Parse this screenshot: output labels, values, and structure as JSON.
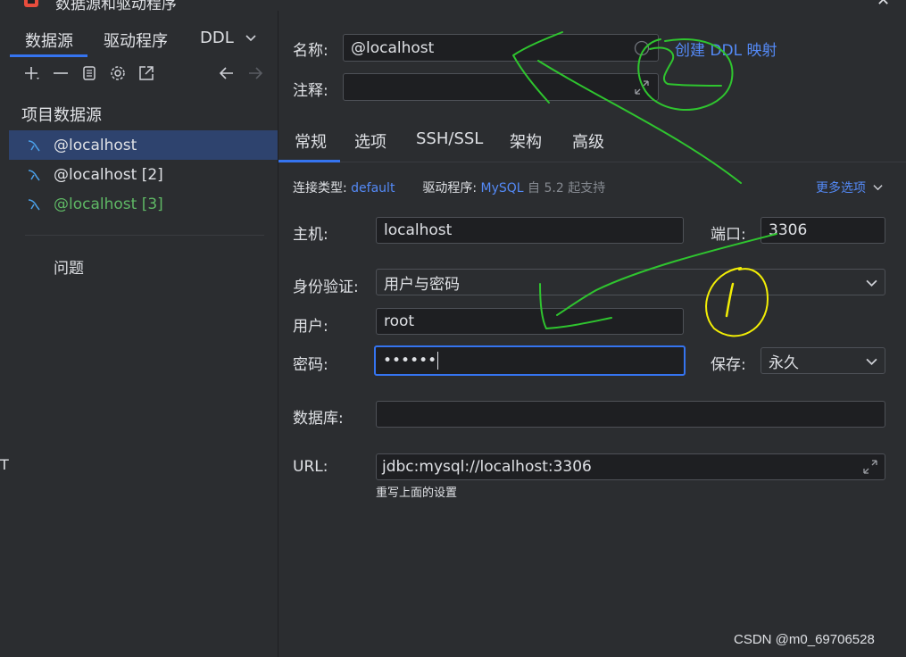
{
  "window": {
    "title": "数据源和驱动程序",
    "close_glyph": "✕"
  },
  "left": {
    "tabs": [
      "数据源",
      "驱动程序",
      "DDL"
    ],
    "project_title": "项目数据源",
    "datasources": [
      {
        "label": "@localhost",
        "color": "#dfe1e5",
        "selected": true
      },
      {
        "label": "@localhost [2]",
        "color": "#dfe1e5",
        "selected": false
      },
      {
        "label": "@localhost [3]",
        "color": "#5fb865",
        "selected": false
      }
    ],
    "problems": "问题",
    "edge_mark": "T",
    "toolbar_icons": [
      "add-icon",
      "remove-icon",
      "copy-icon",
      "settings-icon",
      "goto-icon",
      "back-arrow-icon",
      "forward-arrow-icon"
    ]
  },
  "right": {
    "name_label": "名称:",
    "name_value": "@localhost",
    "create_ddl_link": "创建 DDL 映射",
    "comment_label": "注释:",
    "comment_value": "",
    "tabs": [
      "常规",
      "选项",
      "SSH/SSL",
      "架构",
      "高级"
    ],
    "conn_type_label": "连接类型:",
    "conn_type_value": "default",
    "driver_label": "驱动程序:",
    "driver_value": "MySQL",
    "driver_support": "自 5.2 起支持",
    "more_options": "更多选项",
    "host_label": "主机:",
    "host_value": "localhost",
    "port_label": "端口:",
    "port_value": "3306",
    "auth_label": "身份验证:",
    "auth_value": "用户与密码",
    "user_label": "用户:",
    "user_value": "root",
    "password_label": "密码:",
    "password_value": "••••••",
    "save_label": "保存:",
    "save_value": "永久",
    "database_label": "数据库:",
    "database_value": "",
    "url_label": "URL:",
    "url_value": "jdbc:mysql://localhost:3306",
    "url_hint": "重写上面的设置"
  },
  "annotation_text": {
    "circle_one": "1",
    "circle_two": "2"
  },
  "watermark": "CSDN @m0_69706528",
  "colors": {
    "accent": "#3574f0",
    "link": "#548af7",
    "green_ds": "#5fb865",
    "pen_green": "#2fc52f",
    "pen_yellow": "#f2ee05"
  }
}
